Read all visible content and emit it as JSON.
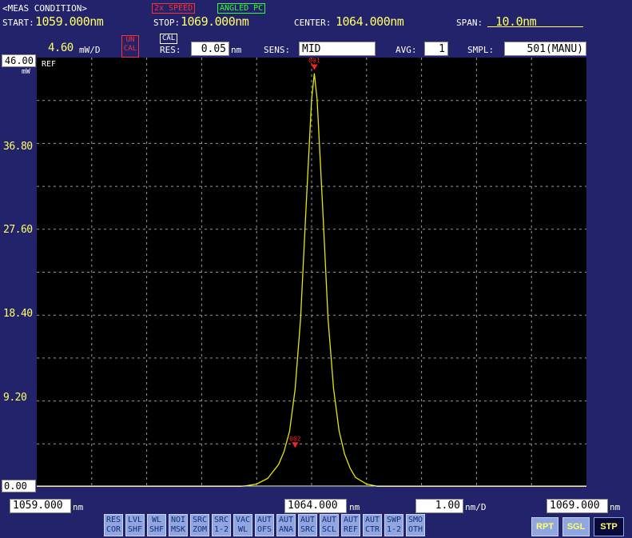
{
  "header": {
    "meas_condition": "<MEAS CONDITION>",
    "tag_speed": "2x SPEED",
    "tag_angled": "ANGLED PC",
    "start_label": "START:",
    "start_value": "1059.000nm",
    "stop_label": "STOP:",
    "stop_value": "1069.000nm",
    "center_label": "CENTER:",
    "center_value": "1064.000nm",
    "span_label": "SPAN:",
    "span_value": "10.0nm"
  },
  "params": {
    "scale_value": "4.60",
    "scale_unit": "mW/D",
    "uncal_line1": "UN",
    "uncal_line2": "CAL",
    "cal": "CAL",
    "res_label": "RES:",
    "res_value": "0.05",
    "res_unit": "nm",
    "sens_label": "SENS:",
    "sens_value": "MID",
    "avg_label": "AVG:",
    "avg_value": "1",
    "smpl_label": "SMPL:",
    "smpl_value": "501(MANU)"
  },
  "plot": {
    "ref_value": "46.00",
    "ref_unit": "mW",
    "ref_label": "REF",
    "y_ticks": [
      "36.80",
      "27.60",
      "18.40",
      "9.20"
    ],
    "bottom_value": "0.00",
    "trace_color": "#e8e800",
    "grid_color": "#9a9a9a",
    "markers": [
      {
        "label": "001",
        "x_nm": 1064.05,
        "y_mw": 44.5
      },
      {
        "label": "002",
        "x_nm": 1063.7,
        "y_mw": 4.0
      }
    ]
  },
  "chart_data": {
    "type": "line",
    "xlabel": "nm",
    "ylabel": "mW",
    "xlim": [
      1059.0,
      1069.0
    ],
    "ylim": [
      0.0,
      46.0
    ],
    "grid": true,
    "series": [
      {
        "x": [
          1059.0,
          1062.6,
          1062.8,
          1063.0,
          1063.2,
          1063.4,
          1063.5,
          1063.6,
          1063.7,
          1063.8,
          1063.9,
          1064.0,
          1064.05,
          1064.1,
          1064.2,
          1064.3,
          1064.4,
          1064.5,
          1064.6,
          1064.7,
          1064.8,
          1065.0,
          1065.2,
          1069.0
        ],
        "y": [
          0.0,
          0.0,
          0.1,
          0.3,
          0.9,
          2.4,
          3.8,
          6.0,
          10.5,
          18.0,
          30.0,
          41.5,
          44.3,
          41.5,
          30.0,
          18.0,
          10.5,
          6.0,
          3.5,
          2.0,
          1.0,
          0.3,
          0.05,
          0.0
        ]
      }
    ]
  },
  "footer": {
    "start": "1059.000",
    "start_unit": "nm",
    "center": "1064.000",
    "center_unit": "nm",
    "div": "1.00",
    "div_unit": "nm/D",
    "stop": "1069.000",
    "stop_unit": "nm"
  },
  "softkeys": [
    {
      "l1": "RES",
      "l2": "COR"
    },
    {
      "l1": "LVL",
      "l2": "SHF"
    },
    {
      "l1": "WL",
      "l2": "SHF"
    },
    {
      "l1": "NOI",
      "l2": "MSK"
    },
    {
      "l1": "SRC",
      "l2": "ZOM"
    },
    {
      "l1": "SRC",
      "l2": "1-2"
    },
    {
      "l1": "VAC",
      "l2": "WL"
    },
    {
      "l1": "AUT",
      "l2": "OFS"
    },
    {
      "l1": "AUT",
      "l2": "ANA"
    },
    {
      "l1": "AUT",
      "l2": "SRC"
    },
    {
      "l1": "AUT",
      "l2": "SCL"
    },
    {
      "l1": "AUT",
      "l2": "REF"
    },
    {
      "l1": "AUT",
      "l2": "CTR"
    },
    {
      "l1": "SWP",
      "l2": "1-2"
    },
    {
      "l1": "SMO",
      "l2": "OTH"
    }
  ],
  "modes": {
    "rpt": "RPT",
    "sgl": "SGL",
    "stp": "STP"
  }
}
